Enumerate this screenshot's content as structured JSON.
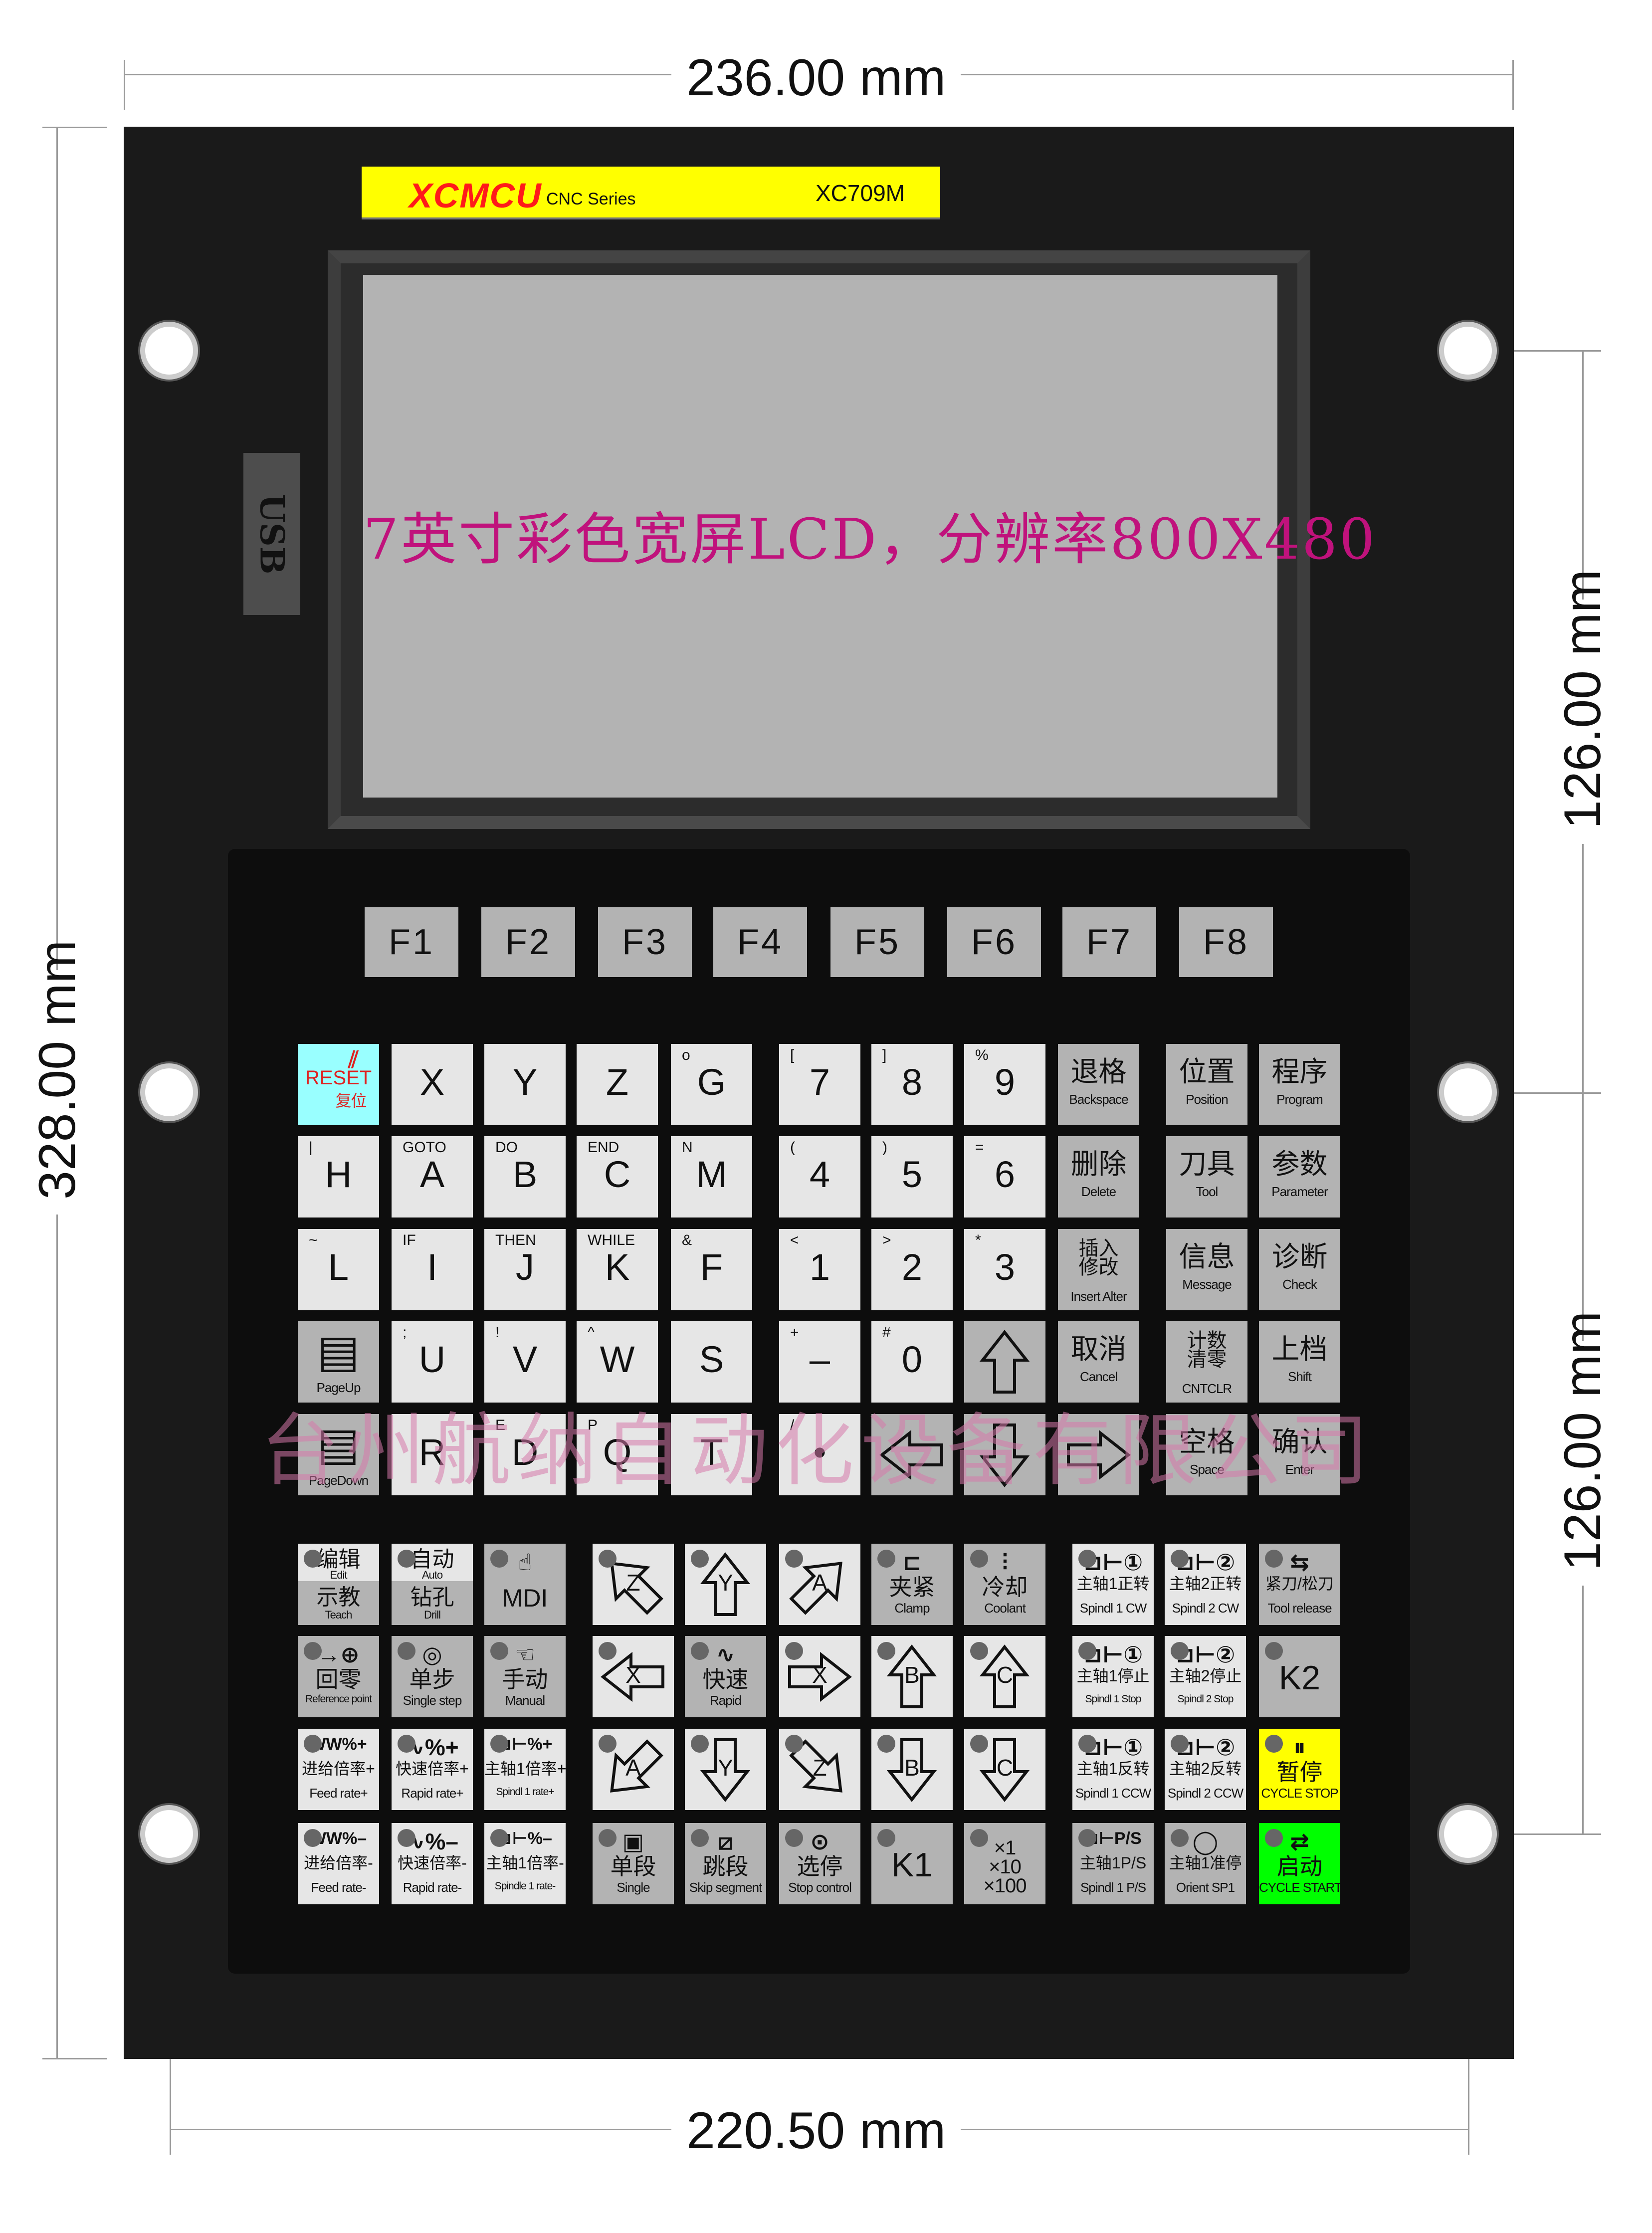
{
  "dimensions": {
    "top": "236.00 mm",
    "bottom": "220.50 mm",
    "left": "328.00 mm",
    "right_upper": "126.00 mm",
    "right_lower": "126.00 mm"
  },
  "brand": {
    "logo": "XCMCU",
    "series": "CNC Series",
    "model": "XC709M"
  },
  "lcd": {
    "text": "7英寸彩色宽屏LCD，分辨率800X480"
  },
  "usb": {
    "label": "USB"
  },
  "watermark": "台州航纳自动化设备有限公司",
  "colors": {
    "panel": "#1a1a1a",
    "key_light": "#e6e6e6",
    "key_gray": "#b3b3b3",
    "reset": "#99ffff",
    "cycle_stop": "#ffff00",
    "cycle_start": "#00ff00",
    "brand_bar": "#ffff00",
    "lcd_text": "#c0127c"
  },
  "function_keys": [
    "F1",
    "F2",
    "F3",
    "F4",
    "F5",
    "F6",
    "F7",
    "F8"
  ],
  "main_keys": [
    [
      {
        "cn": "RESET",
        "en": "复位",
        "bg": "cyan",
        "icon": "reset-icon"
      },
      {
        "m": "X"
      },
      {
        "m": "Y"
      },
      {
        "m": "Z"
      },
      {
        "m": "G",
        "t": "o"
      },
      {
        "m": "7",
        "t": "["
      },
      {
        "m": "8",
        "t": "]"
      },
      {
        "m": "9",
        "t": "%"
      },
      {
        "cn": "退格",
        "en": "Backspace",
        "bg": "gray"
      },
      {
        "cn": "位置",
        "en": "Position",
        "bg": "gray"
      },
      {
        "cn": "程序",
        "en": "Program",
        "bg": "gray"
      }
    ],
    [
      {
        "m": "H",
        "t": "|"
      },
      {
        "m": "A",
        "t": "GOTO"
      },
      {
        "m": "B",
        "t": "DO"
      },
      {
        "m": "C",
        "t": "END"
      },
      {
        "m": "M",
        "t": "N"
      },
      {
        "m": "4",
        "t": "("
      },
      {
        "m": "5",
        "t": ")"
      },
      {
        "m": "6",
        "t": "="
      },
      {
        "cn": "删除",
        "en": "Delete",
        "bg": "gray"
      },
      {
        "cn": "刀具",
        "en": "Tool",
        "bg": "gray"
      },
      {
        "cn": "参数",
        "en": "Parameter",
        "bg": "gray"
      }
    ],
    [
      {
        "m": "L",
        "t": "~"
      },
      {
        "m": "I",
        "t": "IF"
      },
      {
        "m": "J",
        "t": "THEN"
      },
      {
        "m": "K",
        "t": "WHILE"
      },
      {
        "m": "F",
        "t": "&"
      },
      {
        "m": "1",
        "t": "<"
      },
      {
        "m": "2",
        "t": ">"
      },
      {
        "m": "3",
        "t": "*"
      },
      {
        "cn": "插入修改",
        "en": "Insert Alter",
        "bg": "gray"
      },
      {
        "cn": "信息",
        "en": "Message",
        "bg": "gray"
      },
      {
        "cn": "诊断",
        "en": "Check",
        "bg": "gray"
      }
    ],
    [
      {
        "en": "PageUp",
        "bg": "gray",
        "icon": "page-up-icon"
      },
      {
        "m": "U",
        "t": ";"
      },
      {
        "m": "V",
        "t": "!"
      },
      {
        "m": "W",
        "t": "^"
      },
      {
        "m": "S"
      },
      {
        "m": "–",
        "t": "+"
      },
      {
        "m": "0",
        "t": "#"
      },
      {
        "arrow": "up",
        "bg": "gray"
      },
      {
        "cn": "取消",
        "en": "Cancel",
        "bg": "gray"
      },
      {
        "cn": "计数清零",
        "en": "CNTCLR",
        "bg": "gray"
      },
      {
        "cn": "上档",
        "en": "Shift",
        "bg": "gray"
      }
    ],
    [
      {
        "en": "PageDown",
        "bg": "gray",
        "icon": "page-down-icon"
      },
      {
        "m": "R"
      },
      {
        "m": "D",
        "t": "E"
      },
      {
        "m": "Q",
        "t": "P"
      },
      {
        "m": "T"
      },
      {
        "m": "•",
        "t": "/"
      },
      {
        "arrow": "left",
        "bg": "gray"
      },
      {
        "arrow": "down",
        "bg": "gray"
      },
      {
        "arrow": "right",
        "bg": "gray"
      },
      {
        "cn": "空格",
        "en": "Space",
        "bg": "gray"
      },
      {
        "cn": "确认",
        "en": "Enter",
        "bg": "gray"
      }
    ]
  ],
  "mode_keys": [
    [
      {
        "split": true,
        "cn": "编辑",
        "en": "Edit",
        "cn2": "示教",
        "en2": "Teach",
        "led": true
      },
      {
        "split": true,
        "cn": "自动",
        "en": "Auto",
        "cn2": "钻孔",
        "en2": "Drill",
        "led": true
      },
      {
        "m": "MDI",
        "bg": "gray",
        "led": true,
        "icon": "mdi-icon",
        "sym": "☝"
      },
      {
        "arrow": "up-left",
        "letter": "Z",
        "led": true
      },
      {
        "arrow": "up",
        "letter": "Y",
        "led": true
      },
      {
        "arrow": "up-right",
        "letter": "A",
        "led": true
      },
      {
        "cn": "夹紧",
        "en": "Clamp",
        "bg": "gray",
        "led": true,
        "icon": "clamp-icon",
        "sym": "⊏"
      },
      {
        "cn": "冷却",
        "en": "Coolant",
        "bg": "gray",
        "led": true,
        "icon": "coolant-icon",
        "sym": "⫶"
      },
      {
        "cn": "主轴1正转",
        "en": "Spindl 1 CW",
        "led": true,
        "icon": "spindle-cw-icon",
        "sym": "⊐⊢①"
      },
      {
        "cn": "主轴2正转",
        "en": "Spindl 2 CW",
        "led": true,
        "icon": "spindle-cw-icon",
        "sym": "⊐⊢②"
      },
      {
        "cn": "紧刀/松刀",
        "en": "Tool release",
        "bg": "gray",
        "led": true,
        "icon": "tool-release-icon",
        "sym": "⇆"
      }
    ],
    [
      {
        "cn": "回零",
        "en": "Reference point",
        "bg": "gray",
        "led": true,
        "icon": "reference-point-icon",
        "sym": "→⊕"
      },
      {
        "cn": "单步",
        "en": "Single step",
        "bg": "gray",
        "led": true,
        "icon": "single-step-icon",
        "sym": "◎"
      },
      {
        "cn": "手动",
        "en": "Manual",
        "bg": "gray",
        "led": true,
        "icon": "hand-icon",
        "sym": "☜"
      },
      {
        "arrow": "left",
        "letter": "X",
        "led": true
      },
      {
        "cn": "快速",
        "en": "Rapid",
        "bg": "gray",
        "led": true,
        "icon": "rapid-icon",
        "sym": "∿"
      },
      {
        "arrow": "right",
        "letter": "X",
        "led": true
      },
      {
        "arrow": "up",
        "letter": "B",
        "led": true
      },
      {
        "arrow": "up",
        "letter": "C",
        "led": true
      },
      {
        "cn": "主轴1停止",
        "en": "Spindl 1 Stop",
        "led": true,
        "icon": "spindle-stop-icon",
        "sym": "⊐⊢①"
      },
      {
        "cn": "主轴2停止",
        "en": "Spindl 2 Stop",
        "led": true,
        "icon": "spindle-stop-icon",
        "sym": "⊐⊢②"
      },
      {
        "m": "K2",
        "bg": "gray",
        "led": true
      }
    ],
    [
      {
        "cn": "进给倍率+",
        "en": "Feed rate+",
        "led": true,
        "icon": "feed-rate-icon",
        "sym": "WW%+"
      },
      {
        "cn": "快速倍率+",
        "en": "Rapid rate+",
        "led": true,
        "icon": "rapid-rate-icon",
        "sym": "∿%+"
      },
      {
        "cn": "主轴1倍率+",
        "en": "Spindl 1 rate+",
        "led": true,
        "icon": "spindle-rate-icon",
        "sym": "⊐⊢%+"
      },
      {
        "arrow": "down-left",
        "letter": "A",
        "led": true
      },
      {
        "arrow": "down",
        "letter": "Y",
        "led": true
      },
      {
        "arrow": "down-right",
        "letter": "Z",
        "led": true
      },
      {
        "arrow": "down",
        "letter": "B",
        "led": true
      },
      {
        "arrow": "down",
        "letter": "C",
        "led": true
      },
      {
        "cn": "主轴1反转",
        "en": "Spindl 1 CCW",
        "led": true,
        "icon": "spindle-ccw-icon",
        "sym": "⊐⊢①"
      },
      {
        "cn": "主轴2反转",
        "en": "Spindl 2 CCW",
        "led": true,
        "icon": "spindle-ccw-icon",
        "sym": "⊐⊢②"
      },
      {
        "cn": "暂停",
        "en": "CYCLE STOP",
        "bg": "yellow",
        "led": true,
        "icon": "cycle-stop-icon",
        "sym": "⏸"
      }
    ],
    [
      {
        "cn": "进给倍率-",
        "en": "Feed rate-",
        "led": true,
        "icon": "feed-rate-icon",
        "sym": "WW%–"
      },
      {
        "cn": "快速倍率-",
        "en": "Rapid rate-",
        "led": true,
        "icon": "rapid-rate-icon",
        "sym": "∿%–"
      },
      {
        "cn": "主轴1倍率-",
        "en": "Spindle 1 rate-",
        "led": true,
        "icon": "spindle-rate-icon",
        "sym": "⊐⊢%–"
      },
      {
        "cn": "单段",
        "en": "Single",
        "bg": "gray",
        "led": true,
        "icon": "single-block-icon",
        "sym": "▣"
      },
      {
        "cn": "跳段",
        "en": "Skip segment",
        "bg": "gray",
        "led": true,
        "icon": "skip-block-icon",
        "sym": "⧄"
      },
      {
        "cn": "选停",
        "en": "Stop control",
        "bg": "gray",
        "led": true,
        "icon": "optional-stop-icon",
        "sym": "⊙"
      },
      {
        "m": "K1",
        "bg": "gray",
        "led": true
      },
      {
        "lines": [
          "×1",
          "×10",
          "×100"
        ],
        "bg": "gray",
        "led": true
      },
      {
        "cn": "主轴1P/S",
        "en": "Spindl 1 P/S",
        "bg": "gray",
        "led": true,
        "icon": "spindle-ps-icon",
        "sym": "⊐⊢P/S"
      },
      {
        "cn": "主轴1准停",
        "en": "Orient SP1",
        "bg": "gray",
        "led": true,
        "icon": "orient-icon",
        "sym": "◯"
      },
      {
        "cn": "启动",
        "en": "CYCLE START",
        "bg": "green",
        "led": true,
        "icon": "cycle-start-icon",
        "sym": "⇄"
      }
    ]
  ]
}
